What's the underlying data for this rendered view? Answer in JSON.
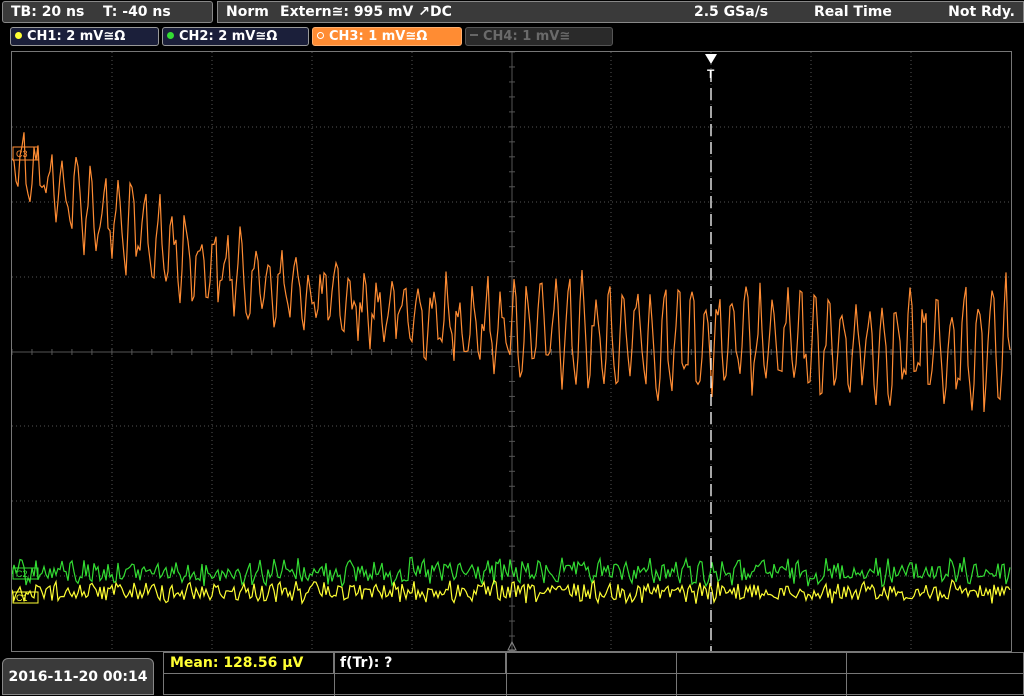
{
  "header": {
    "timebase": "TB: 20 ns",
    "trigger_offset": "T: -40 ns",
    "trigger_mode": "Norm",
    "trigger_source": "Extern≅: 995 mV ↗DC",
    "sample_rate": "2.5 GSa/s",
    "acq_mode": "Real Time",
    "run_state": "Not Rdy."
  },
  "channels": [
    {
      "label": "CH1: 2 mV≅Ω",
      "color": "#ffff33",
      "active": true
    },
    {
      "label": "CH2: 2 mV≅Ω",
      "color": "#33dd33",
      "active": true
    },
    {
      "label": "CH3: 1 mV≅Ω",
      "color": "#ff8c33",
      "active": true
    },
    {
      "label": "CH4: 1 mV≅",
      "color": "#666666",
      "active": false
    }
  ],
  "markers": {
    "ch3": "C3",
    "ch2": "C2",
    "ch1": "C1",
    "trigger": "T"
  },
  "footer": {
    "datetime": "2016-11-20 00:14",
    "measurement": "Mean: 128.56 µV",
    "trigger_freq": "f(Tr): ?"
  },
  "colors": {
    "ch1": "#ffff33",
    "ch2": "#33dd33",
    "ch3": "#ff8c33",
    "grid": "#555555",
    "panel": "#3a3a3a"
  }
}
